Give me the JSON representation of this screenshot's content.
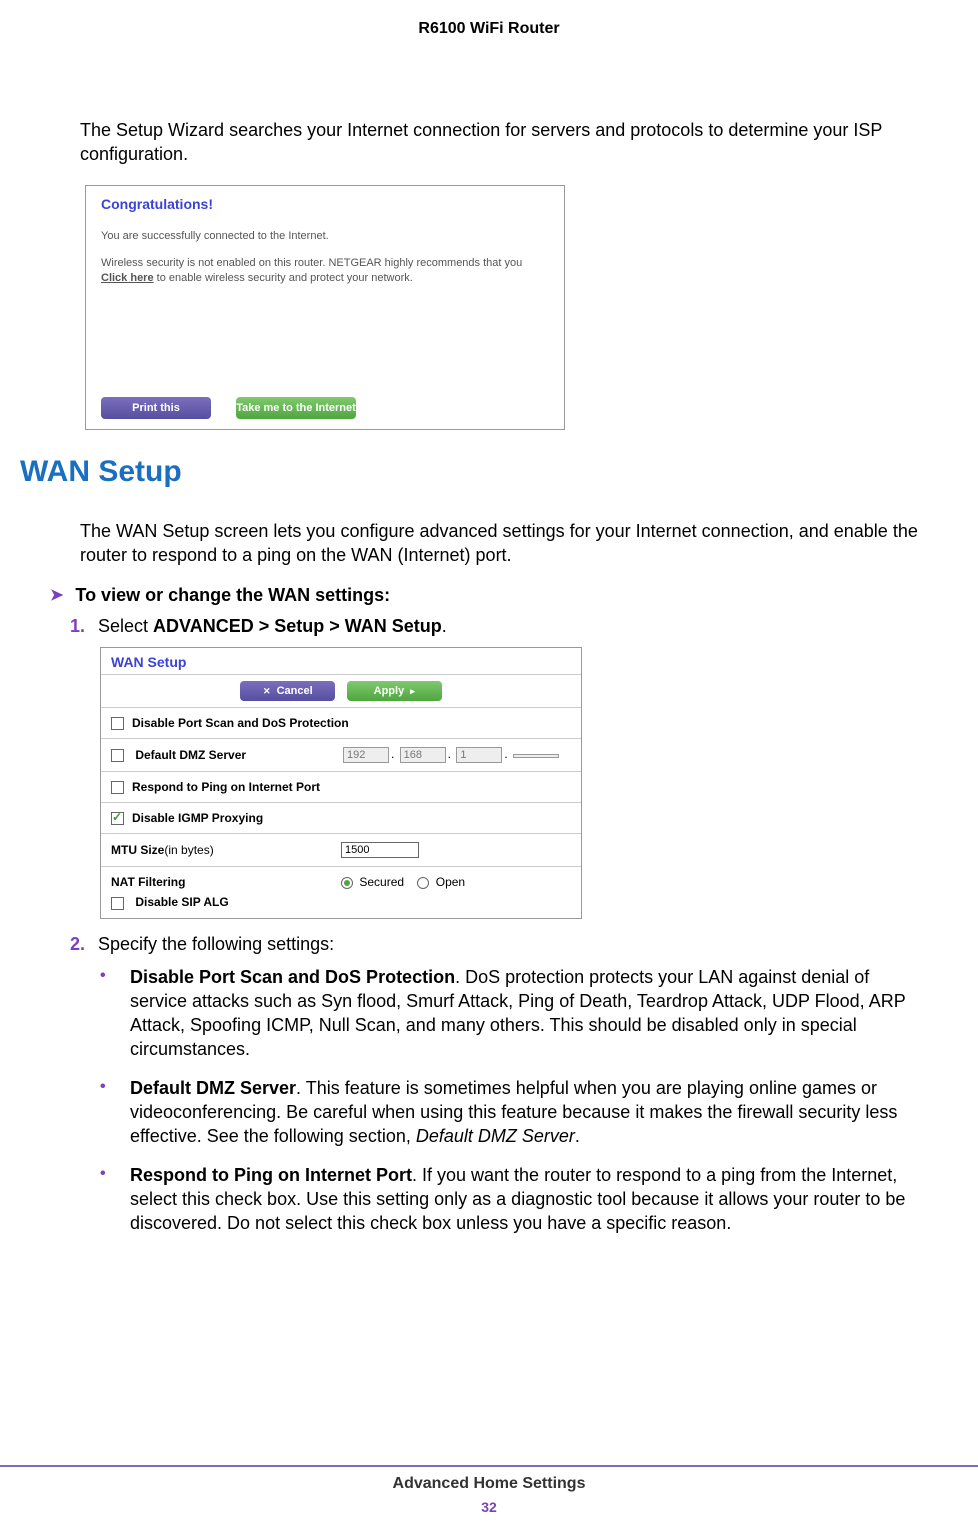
{
  "header": {
    "title": "R6100 WiFi Router"
  },
  "intro_para": "The Setup Wizard searches your Internet connection for servers and protocols to determine your ISP configuration.",
  "congrats": {
    "heading": "Congratulations!",
    "line1": "You are successfully connected to the Internet.",
    "line2_a": "Wireless security is not enabled on this router. NETGEAR highly recommends that you ",
    "line2_link": "Click here",
    "line2_b": " to enable wireless security and protect your network.",
    "print_btn": "Print this",
    "internet_btn": "Take me to the Internet"
  },
  "section_heading": "WAN Setup",
  "wan_intro": "The WAN Setup screen lets you configure advanced settings for your Internet connection, and enable the router to respond to a ping on the WAN (Internet) port.",
  "proc_heading": "To view or change the WAN settings:",
  "step1": {
    "num": "1.",
    "text_a": "Select ",
    "text_b": "ADVANCED > Setup > WAN Setup",
    "text_c": "."
  },
  "wan_panel": {
    "title": "WAN Setup",
    "cancel": "Cancel",
    "apply": "Apply",
    "opt_portscan": "Disable Port Scan and DoS Protection",
    "opt_dmz": "Default DMZ Server",
    "ip1": "192",
    "ip2": "168",
    "ip3": "1",
    "ip4": "",
    "opt_ping": "Respond to Ping on Internet Port",
    "opt_igmp": "Disable IGMP Proxying",
    "mtu_label": "MTU Size",
    "mtu_unit": "(in bytes)",
    "mtu_val": "1500",
    "nat_label": "NAT Filtering",
    "nat_secured": "Secured",
    "nat_open": "Open",
    "opt_sip": "Disable SIP ALG"
  },
  "step2": {
    "num": "2.",
    "text": "Specify the following settings:"
  },
  "bullets": [
    {
      "title": "Disable Port Scan and DoS Protection",
      "body": ". DoS protection protects your LAN against denial of service attacks such as Syn flood, Smurf Attack, Ping of Death, Teardrop Attack, UDP Flood, ARP Attack, Spoofing ICMP, Null Scan, and many others. This should be disabled only in special circumstances."
    },
    {
      "title": "Default DMZ Server",
      "body": ". This feature is sometimes helpful when you are playing online games or videoconferencing. Be careful when using this feature because it makes the firewall security less effective. See the following section, ",
      "link": "Default DMZ Server",
      "tail": "."
    },
    {
      "title": "Respond to Ping on Internet Port",
      "body": ". If you want the router to respond to a ping from the Internet, select this check box. Use this setting only as a diagnostic tool because it allows your router to be discovered. Do not select this check box unless you have a specific reason."
    }
  ],
  "footer": {
    "section": "Advanced Home Settings",
    "page": "32"
  }
}
